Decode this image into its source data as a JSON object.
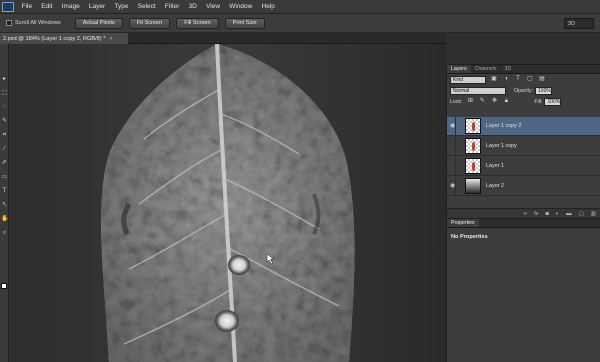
{
  "menubar": {
    "items": [
      "File",
      "Edit",
      "Image",
      "Layer",
      "Type",
      "Select",
      "Filter",
      "3D",
      "View",
      "Window",
      "Help"
    ]
  },
  "options_bar": {
    "scroll_all_label": "Scroll All Windows",
    "buttons": [
      "Actual Pixels",
      "Fit Screen",
      "Fill Screen",
      "Print Size"
    ],
    "workspace_label": "3D"
  },
  "document": {
    "tab_title": "2.psd @ 184% (Layer 1 copy 2, RGB/8) *",
    "close_glyph": "×"
  },
  "layers_panel": {
    "tabs": [
      "Layers",
      "Channels",
      "3D"
    ],
    "kind_label": "Kind",
    "blend_mode": "Normal",
    "opacity_label": "Opacity:",
    "opacity_value": "100%",
    "lock_label": "Lock:",
    "fill_label": "Fill:",
    "fill_value": "100%",
    "layers": [
      {
        "name": "Layer 1 copy 2",
        "selected": true,
        "visible": true
      },
      {
        "name": "Layer 1 copy",
        "selected": false,
        "visible": false
      },
      {
        "name": "Layer 1",
        "selected": false,
        "visible": false
      },
      {
        "name": "Layer 2",
        "selected": false,
        "visible": true
      }
    ],
    "footer_icons": [
      "link-icon",
      "fx-icon",
      "mask-icon",
      "adjustment-icon",
      "folder-icon",
      "new-layer-icon",
      "trash-icon"
    ]
  },
  "properties_panel": {
    "tab": "Properties",
    "message": "No Properties"
  }
}
